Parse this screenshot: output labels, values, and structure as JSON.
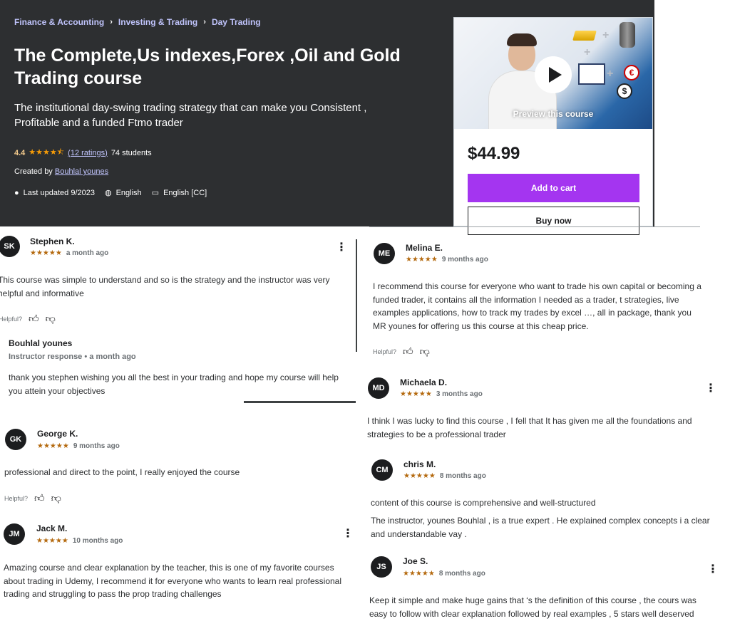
{
  "breadcrumbs": [
    "Finance & Accounting",
    "Investing & Trading",
    "Day Trading"
  ],
  "course": {
    "title": "The Complete,Us indexes,Forex ,Oil and Gold Trading course",
    "subtitle": "The institutional day-swing trading strategy that can make you Consistent , Profitable and a funded Ftmo trader",
    "rating": "4.4",
    "stars": "★★★★⯪",
    "ratings_link": "(12 ratings)",
    "students": "74 students",
    "created_by_label": "Created by",
    "instructor": "Bouhlal younes",
    "last_updated": "Last updated 9/2023",
    "language": "English",
    "captions": "English [CC]"
  },
  "purchase": {
    "preview_label": "Preview this course",
    "price": "$44.99",
    "add_to_cart": "Add to cart",
    "buy_now": "Buy now"
  },
  "helpful_label": "Helpful?",
  "reviews": [
    {
      "initials": "SK",
      "name": "Stephen K.",
      "stars": "★★★★★",
      "when": "a month ago",
      "text": "This course was simple to understand and so is the strategy and the instructor was very helpful and informative",
      "response": {
        "name": "Bouhlal younes",
        "meta": "Instructor response • a month ago",
        "text": "thank you stephen wishing you all the best in your trading and hope my course will help you attein your objectives"
      }
    },
    {
      "initials": "GK",
      "name": "George K.",
      "stars": "★★★★★",
      "when": "9 months ago",
      "text": "professional and direct to the point, I really enjoyed the course"
    },
    {
      "initials": "JM",
      "name": "Jack M.",
      "stars": "★★★★★",
      "when": "10 months ago",
      "text": "Amazing course and clear explanation by the teacher, this is one of my favorite courses about trading in Udemy, I recommend it for everyone who wants to learn real professional trading and struggling to pass the prop trading challenges"
    },
    {
      "initials": "ME",
      "name": "Melina E.",
      "stars": "★★★★★",
      "when": "9 months ago",
      "text": "I recommend this course for everyone who want to trade his own capital or becoming a funded trader, it contains all the information I needed as a trader, t strategies, live examples applications, how to track my trades by excel …, all in package, thank you MR younes for offering us this course at this cheap price."
    },
    {
      "initials": "MD",
      "name": "Michaela D.",
      "stars": "★★★★★",
      "when": "3 months ago",
      "text": "I think I was lucky to find this course , I fell that It has given me all the foundations and strategies to be a professional trader"
    },
    {
      "initials": "CM",
      "name": "chris M.",
      "stars": "★★★★★",
      "when": "8 months ago",
      "text": "content of this course is comprehensive and well-structured",
      "text2": "The instructor, younes Bouhlal , is a true expert . He explained complex concepts i a clear and understandable vay ."
    },
    {
      "initials": "JS",
      "name": "Joe S.",
      "stars": "★★★★★",
      "when": "8 months ago",
      "text": "Keep it simple and make huge gains that ‘s the definition of this course , the cours was easy to follow with clear explanation followed by real examples , 5 stars well deserved"
    }
  ]
}
